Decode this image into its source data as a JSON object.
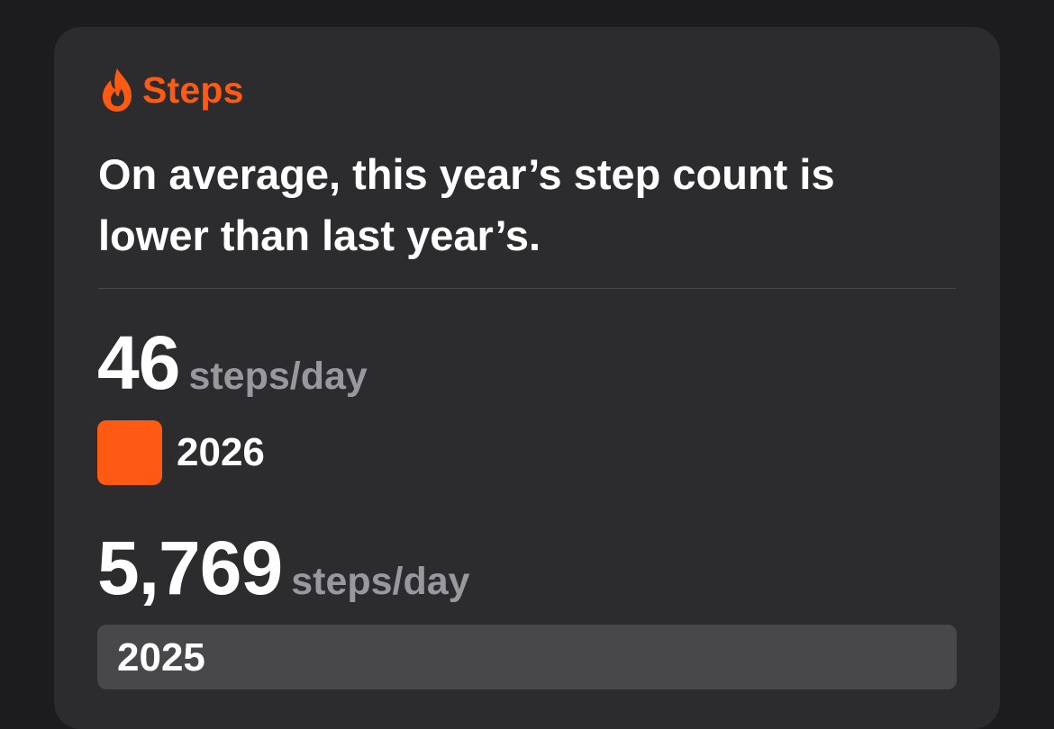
{
  "colors": {
    "accent": "#ff5a14",
    "bar_previous": "#48484a",
    "card_background": "#2c2c2e",
    "page_background": "#1c1c1e"
  },
  "header": {
    "icon": "flame-icon",
    "title": "Steps"
  },
  "headline": "On average, this year’s step count is lower than last year’s.",
  "comparison": [
    {
      "year": "2026",
      "value": "46",
      "unit": "steps/day",
      "steps": 46
    },
    {
      "year": "2025",
      "value": "5,769",
      "unit": "steps/day",
      "steps": 5769
    }
  ]
}
